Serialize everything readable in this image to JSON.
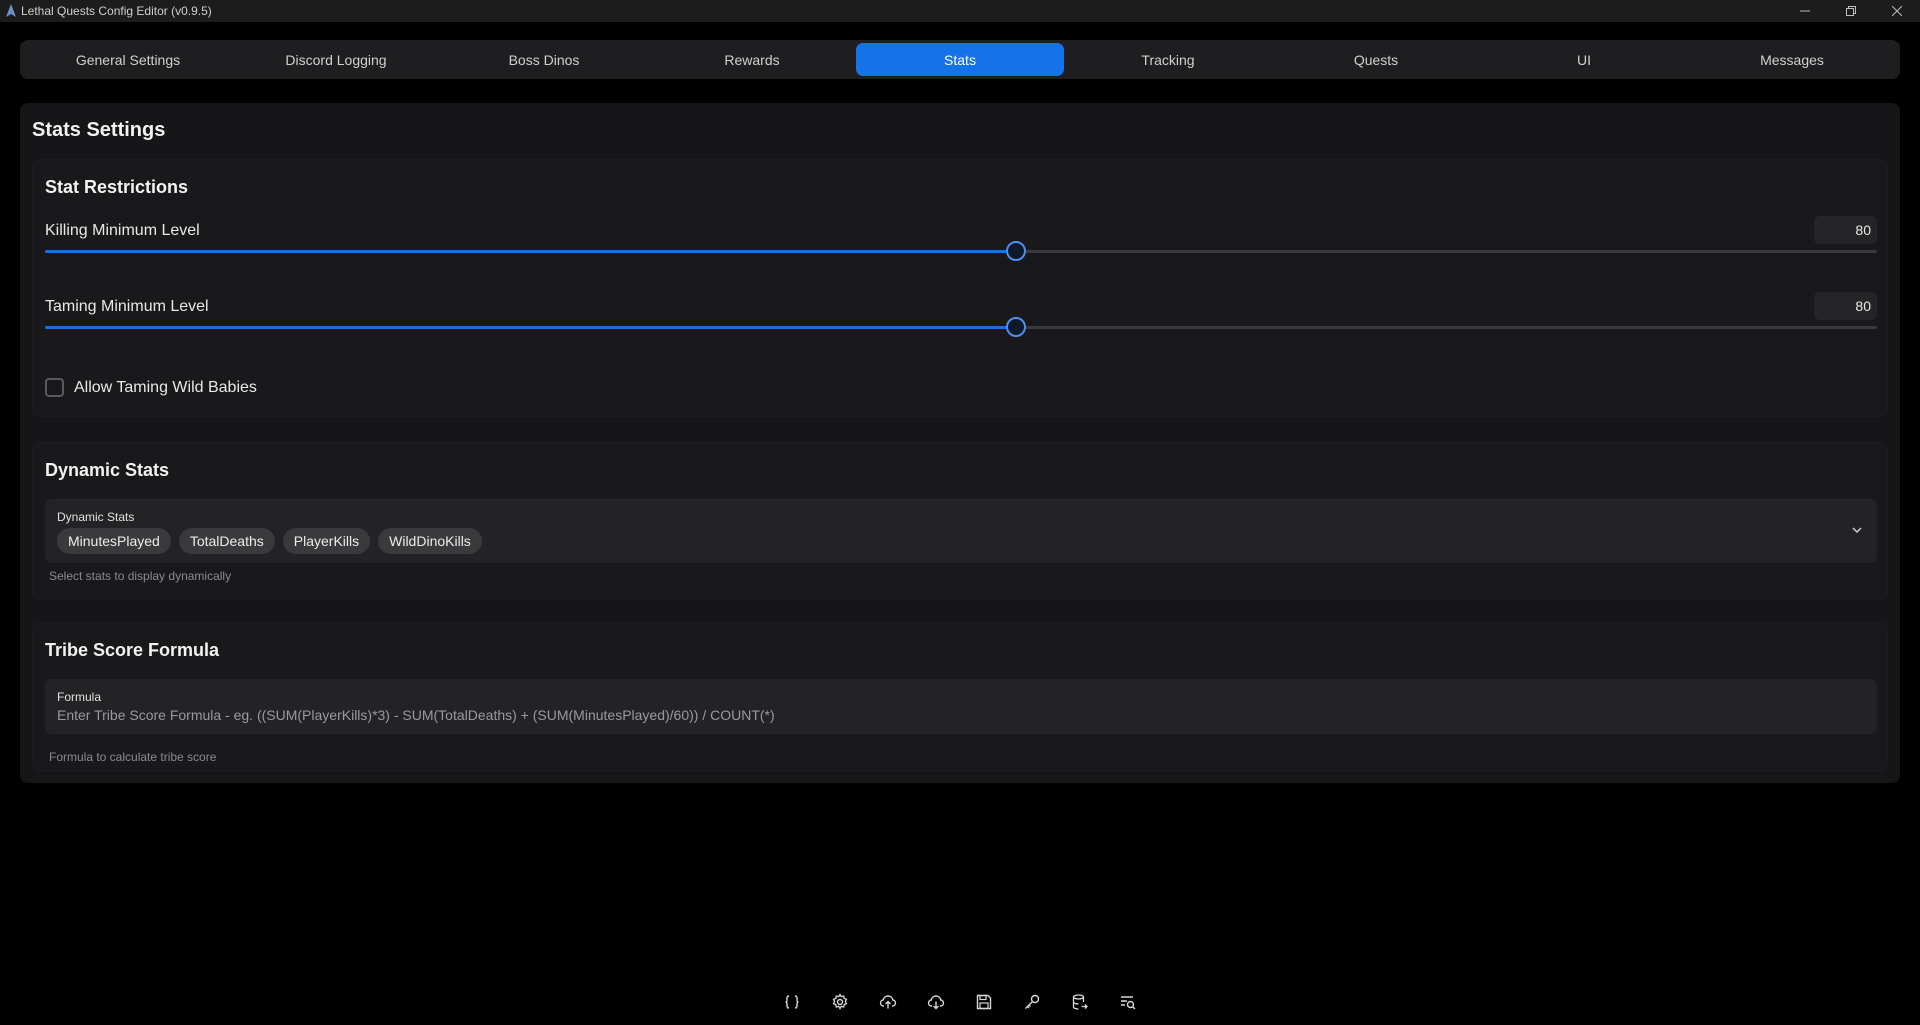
{
  "window": {
    "title": "Lethal Quests Config Editor (v0.9.5)",
    "minimize_icon": "minimize-icon",
    "restore_icon": "restore-icon",
    "close_icon": "close-icon"
  },
  "tabs": [
    {
      "label": "General Settings",
      "active": false
    },
    {
      "label": "Discord Logging",
      "active": false
    },
    {
      "label": "Boss Dinos",
      "active": false
    },
    {
      "label": "Rewards",
      "active": false
    },
    {
      "label": "Stats",
      "active": true
    },
    {
      "label": "Tracking",
      "active": false
    },
    {
      "label": "Quests",
      "active": false
    },
    {
      "label": "UI",
      "active": false
    },
    {
      "label": "Messages",
      "active": false
    }
  ],
  "page": {
    "title": "Stats Settings",
    "stat_restrictions": {
      "title": "Stat Restrictions",
      "killing": {
        "label": "Killing Minimum Level",
        "value": "80",
        "fraction": 0.53
      },
      "taming": {
        "label": "Taming Minimum Level",
        "value": "80",
        "fraction": 0.53
      },
      "allow_wild_babies": {
        "label": "Allow Taming Wild Babies",
        "checked": false
      }
    },
    "dynamic_stats": {
      "title": "Dynamic Stats",
      "field_label": "Dynamic Stats",
      "chips": [
        "MinutesPlayed",
        "TotalDeaths",
        "PlayerKills",
        "WildDinoKills"
      ],
      "helper": "Select stats to display dynamically"
    },
    "tribe_score": {
      "title": "Tribe Score Formula",
      "field_label": "Formula",
      "value": "",
      "placeholder": "Enter Tribe Score Formula - eg. ((SUM(PlayerKills)*3) - SUM(TotalDeaths) + (SUM(MinutesPlayed)/60)) / COUNT(*)",
      "helper": "Formula to calculate tribe score"
    }
  },
  "toolbar": [
    "braces-icon",
    "gear-icon",
    "cloud-upload-icon",
    "cloud-download-icon",
    "save-icon",
    "key-icon",
    "database-export-icon",
    "search-list-icon"
  ],
  "colors": {
    "accent": "#1572e8",
    "background": "#000000",
    "panel": "#161618"
  }
}
